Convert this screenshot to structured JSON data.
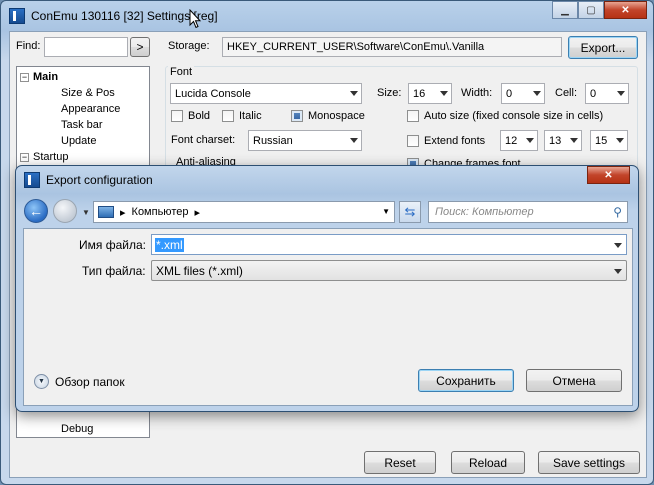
{
  "main_window": {
    "title": "ConEmu 130116 [32] Settings [reg]",
    "find_label": "Find:",
    "find_value": "",
    "find_button": ">",
    "storage_label": "Storage:",
    "storage_value": "HKEY_CURRENT_USER\\Software\\ConEmu\\.Vanilla",
    "export_button": "Export...",
    "tree": [
      {
        "label": "Main",
        "expander": "−",
        "bold": true
      },
      {
        "label": "Size & Pos"
      },
      {
        "label": "Appearance"
      },
      {
        "label": "Task bar"
      },
      {
        "label": "Update"
      },
      {
        "label": "Startup",
        "expander": "−"
      },
      {
        "label": "Debug"
      }
    ],
    "font_group": {
      "title": "Font",
      "font_value": "Lucida Console",
      "size_label": "Size:",
      "size_value": "16",
      "width_label": "Width:",
      "width_value": "0",
      "cell_label": "Cell:",
      "cell_value": "0",
      "bold": "Bold",
      "italic": "Italic",
      "monospace": "Monospace",
      "auto_size": "Auto size (fixed console size in cells)",
      "charset_label": "Font charset:",
      "charset_value": "Russian",
      "extend_fonts": "Extend fonts",
      "extend_1": "12",
      "extend_2": "13",
      "extend_3": "15",
      "anti_aliasing": "Anti-aliasing",
      "change_frames": "Change frames font"
    },
    "reset_button": "Reset",
    "reload_button": "Reload",
    "save_button": "Save settings"
  },
  "dialog": {
    "title": "Export configuration",
    "path": "Компьютер",
    "search_placeholder": "Поиск: Компьютер",
    "filename_label": "Имя файла:",
    "filename_value": "*.xml",
    "filetype_label": "Тип файла:",
    "filetype_value": "XML files (*.xml)",
    "browse_folders": "Обзор папок",
    "save_button": "Сохранить",
    "cancel_button": "Отмена"
  },
  "colors": {
    "accent": "#3399ff",
    "selection": "#3399ff",
    "close": "#c2442a"
  }
}
